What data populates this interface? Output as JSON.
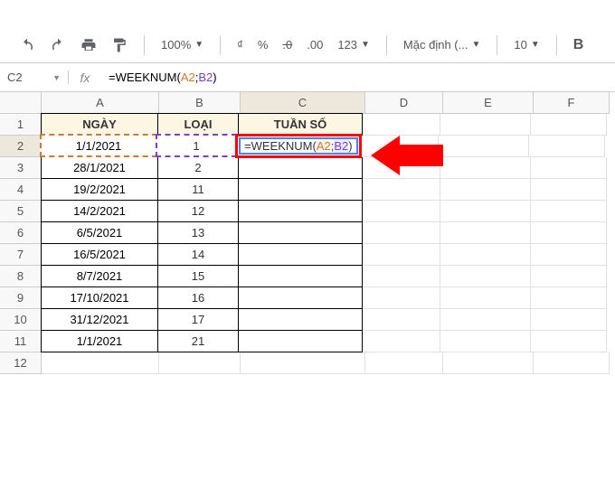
{
  "toolbar": {
    "zoom": "100%",
    "currency": "₫",
    "percent": "%",
    "dec_less": ".0",
    "dec_more": ".00",
    "num_format": "123",
    "font": "Mặc định (...",
    "font_size": "10",
    "bold": "B"
  },
  "namebox": {
    "value": "C2"
  },
  "formula": {
    "prefix": "=WEEKNUM(",
    "ref1": "A2",
    "sep": ";",
    "ref2": "B2",
    "suffix": ")"
  },
  "columns": [
    "A",
    "B",
    "C",
    "D",
    "E",
    "F"
  ],
  "headers": {
    "A": "NGÀY",
    "B": "LOẠI",
    "C": "TUẦN SỐ"
  },
  "rows": [
    {
      "n": "1"
    },
    {
      "n": "2",
      "A": "1/1/2021",
      "B": "1"
    },
    {
      "n": "3",
      "A": "28/1/2021",
      "B": "2"
    },
    {
      "n": "4",
      "A": "19/2/2021",
      "B": "11"
    },
    {
      "n": "5",
      "A": "14/2/2021",
      "B": "12"
    },
    {
      "n": "6",
      "A": "6/5/2021",
      "B": "13"
    },
    {
      "n": "7",
      "A": "16/5/2021",
      "B": "14"
    },
    {
      "n": "8",
      "A": "8/7/2021",
      "B": "15"
    },
    {
      "n": "9",
      "A": "17/10/2021",
      "B": "16"
    },
    {
      "n": "10",
      "A": "31/12/2021",
      "B": "17"
    },
    {
      "n": "11",
      "A": "1/1/2021",
      "B": "21"
    },
    {
      "n": "12"
    }
  ],
  "chart_data": {
    "type": "table",
    "title": "",
    "columns": [
      "NGÀY",
      "LOẠI",
      "TUẦN SỐ"
    ],
    "data": [
      [
        "1/1/2021",
        1,
        "=WEEKNUM(A2;B2)"
      ],
      [
        "28/1/2021",
        2,
        ""
      ],
      [
        "19/2/2021",
        11,
        ""
      ],
      [
        "14/2/2021",
        12,
        ""
      ],
      [
        "6/5/2021",
        13,
        ""
      ],
      [
        "16/5/2021",
        14,
        ""
      ],
      [
        "8/7/2021",
        15,
        ""
      ],
      [
        "17/10/2021",
        16,
        ""
      ],
      [
        "31/12/2021",
        17,
        ""
      ],
      [
        "1/1/2021",
        21,
        ""
      ]
    ]
  }
}
